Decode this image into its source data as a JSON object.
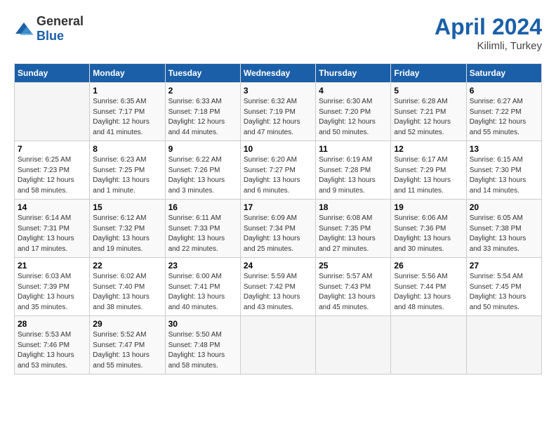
{
  "header": {
    "logo_general": "General",
    "logo_blue": "Blue",
    "month_year": "April 2024",
    "location": "Kilimli, Turkey"
  },
  "days_of_week": [
    "Sunday",
    "Monday",
    "Tuesday",
    "Wednesday",
    "Thursday",
    "Friday",
    "Saturday"
  ],
  "weeks": [
    [
      {
        "day": "",
        "sunrise": "",
        "sunset": "",
        "daylight": ""
      },
      {
        "day": "1",
        "sunrise": "Sunrise: 6:35 AM",
        "sunset": "Sunset: 7:17 PM",
        "daylight": "Daylight: 12 hours and 41 minutes."
      },
      {
        "day": "2",
        "sunrise": "Sunrise: 6:33 AM",
        "sunset": "Sunset: 7:18 PM",
        "daylight": "Daylight: 12 hours and 44 minutes."
      },
      {
        "day": "3",
        "sunrise": "Sunrise: 6:32 AM",
        "sunset": "Sunset: 7:19 PM",
        "daylight": "Daylight: 12 hours and 47 minutes."
      },
      {
        "day": "4",
        "sunrise": "Sunrise: 6:30 AM",
        "sunset": "Sunset: 7:20 PM",
        "daylight": "Daylight: 12 hours and 50 minutes."
      },
      {
        "day": "5",
        "sunrise": "Sunrise: 6:28 AM",
        "sunset": "Sunset: 7:21 PM",
        "daylight": "Daylight: 12 hours and 52 minutes."
      },
      {
        "day": "6",
        "sunrise": "Sunrise: 6:27 AM",
        "sunset": "Sunset: 7:22 PM",
        "daylight": "Daylight: 12 hours and 55 minutes."
      }
    ],
    [
      {
        "day": "7",
        "sunrise": "Sunrise: 6:25 AM",
        "sunset": "Sunset: 7:23 PM",
        "daylight": "Daylight: 12 hours and 58 minutes."
      },
      {
        "day": "8",
        "sunrise": "Sunrise: 6:23 AM",
        "sunset": "Sunset: 7:25 PM",
        "daylight": "Daylight: 13 hours and 1 minute."
      },
      {
        "day": "9",
        "sunrise": "Sunrise: 6:22 AM",
        "sunset": "Sunset: 7:26 PM",
        "daylight": "Daylight: 13 hours and 3 minutes."
      },
      {
        "day": "10",
        "sunrise": "Sunrise: 6:20 AM",
        "sunset": "Sunset: 7:27 PM",
        "daylight": "Daylight: 13 hours and 6 minutes."
      },
      {
        "day": "11",
        "sunrise": "Sunrise: 6:19 AM",
        "sunset": "Sunset: 7:28 PM",
        "daylight": "Daylight: 13 hours and 9 minutes."
      },
      {
        "day": "12",
        "sunrise": "Sunrise: 6:17 AM",
        "sunset": "Sunset: 7:29 PM",
        "daylight": "Daylight: 13 hours and 11 minutes."
      },
      {
        "day": "13",
        "sunrise": "Sunrise: 6:15 AM",
        "sunset": "Sunset: 7:30 PM",
        "daylight": "Daylight: 13 hours and 14 minutes."
      }
    ],
    [
      {
        "day": "14",
        "sunrise": "Sunrise: 6:14 AM",
        "sunset": "Sunset: 7:31 PM",
        "daylight": "Daylight: 13 hours and 17 minutes."
      },
      {
        "day": "15",
        "sunrise": "Sunrise: 6:12 AM",
        "sunset": "Sunset: 7:32 PM",
        "daylight": "Daylight: 13 hours and 19 minutes."
      },
      {
        "day": "16",
        "sunrise": "Sunrise: 6:11 AM",
        "sunset": "Sunset: 7:33 PM",
        "daylight": "Daylight: 13 hours and 22 minutes."
      },
      {
        "day": "17",
        "sunrise": "Sunrise: 6:09 AM",
        "sunset": "Sunset: 7:34 PM",
        "daylight": "Daylight: 13 hours and 25 minutes."
      },
      {
        "day": "18",
        "sunrise": "Sunrise: 6:08 AM",
        "sunset": "Sunset: 7:35 PM",
        "daylight": "Daylight: 13 hours and 27 minutes."
      },
      {
        "day": "19",
        "sunrise": "Sunrise: 6:06 AM",
        "sunset": "Sunset: 7:36 PM",
        "daylight": "Daylight: 13 hours and 30 minutes."
      },
      {
        "day": "20",
        "sunrise": "Sunrise: 6:05 AM",
        "sunset": "Sunset: 7:38 PM",
        "daylight": "Daylight: 13 hours and 33 minutes."
      }
    ],
    [
      {
        "day": "21",
        "sunrise": "Sunrise: 6:03 AM",
        "sunset": "Sunset: 7:39 PM",
        "daylight": "Daylight: 13 hours and 35 minutes."
      },
      {
        "day": "22",
        "sunrise": "Sunrise: 6:02 AM",
        "sunset": "Sunset: 7:40 PM",
        "daylight": "Daylight: 13 hours and 38 minutes."
      },
      {
        "day": "23",
        "sunrise": "Sunrise: 6:00 AM",
        "sunset": "Sunset: 7:41 PM",
        "daylight": "Daylight: 13 hours and 40 minutes."
      },
      {
        "day": "24",
        "sunrise": "Sunrise: 5:59 AM",
        "sunset": "Sunset: 7:42 PM",
        "daylight": "Daylight: 13 hours and 43 minutes."
      },
      {
        "day": "25",
        "sunrise": "Sunrise: 5:57 AM",
        "sunset": "Sunset: 7:43 PM",
        "daylight": "Daylight: 13 hours and 45 minutes."
      },
      {
        "day": "26",
        "sunrise": "Sunrise: 5:56 AM",
        "sunset": "Sunset: 7:44 PM",
        "daylight": "Daylight: 13 hours and 48 minutes."
      },
      {
        "day": "27",
        "sunrise": "Sunrise: 5:54 AM",
        "sunset": "Sunset: 7:45 PM",
        "daylight": "Daylight: 13 hours and 50 minutes."
      }
    ],
    [
      {
        "day": "28",
        "sunrise": "Sunrise: 5:53 AM",
        "sunset": "Sunset: 7:46 PM",
        "daylight": "Daylight: 13 hours and 53 minutes."
      },
      {
        "day": "29",
        "sunrise": "Sunrise: 5:52 AM",
        "sunset": "Sunset: 7:47 PM",
        "daylight": "Daylight: 13 hours and 55 minutes."
      },
      {
        "day": "30",
        "sunrise": "Sunrise: 5:50 AM",
        "sunset": "Sunset: 7:48 PM",
        "daylight": "Daylight: 13 hours and 58 minutes."
      },
      {
        "day": "",
        "sunrise": "",
        "sunset": "",
        "daylight": ""
      },
      {
        "day": "",
        "sunrise": "",
        "sunset": "",
        "daylight": ""
      },
      {
        "day": "",
        "sunrise": "",
        "sunset": "",
        "daylight": ""
      },
      {
        "day": "",
        "sunrise": "",
        "sunset": "",
        "daylight": ""
      }
    ]
  ]
}
